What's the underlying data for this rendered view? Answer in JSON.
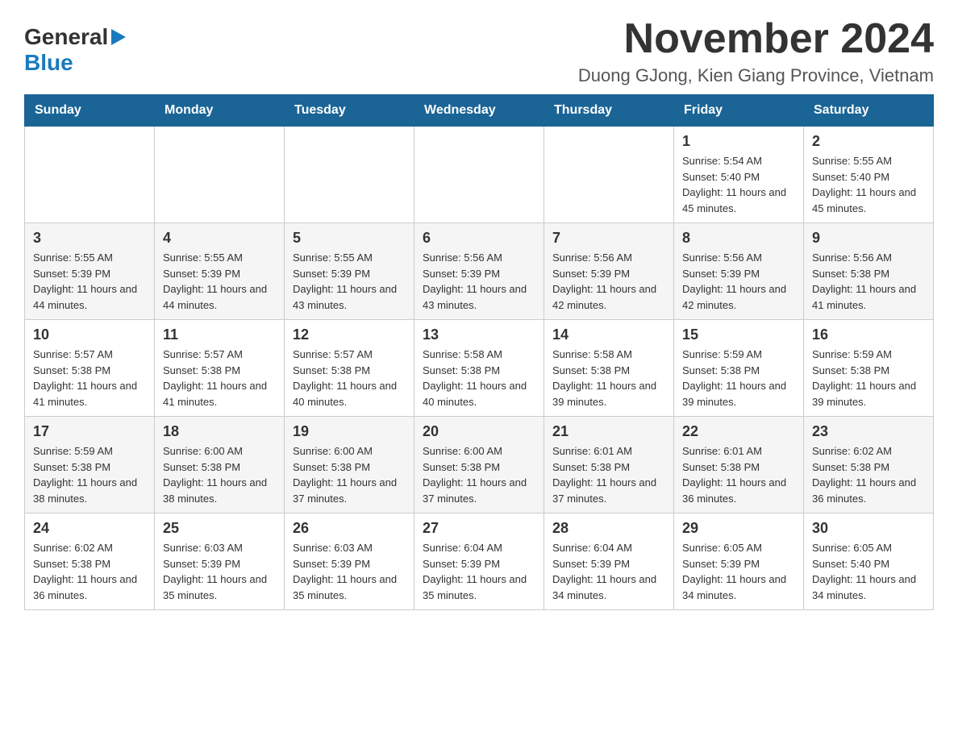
{
  "header": {
    "logo_general": "General",
    "logo_blue": "Blue",
    "month_title": "November 2024",
    "location": "Duong GJong, Kien Giang Province, Vietnam"
  },
  "weekdays": [
    "Sunday",
    "Monday",
    "Tuesday",
    "Wednesday",
    "Thursday",
    "Friday",
    "Saturday"
  ],
  "weeks": [
    [
      {
        "day": "",
        "info": ""
      },
      {
        "day": "",
        "info": ""
      },
      {
        "day": "",
        "info": ""
      },
      {
        "day": "",
        "info": ""
      },
      {
        "day": "",
        "info": ""
      },
      {
        "day": "1",
        "info": "Sunrise: 5:54 AM\nSunset: 5:40 PM\nDaylight: 11 hours and 45 minutes."
      },
      {
        "day": "2",
        "info": "Sunrise: 5:55 AM\nSunset: 5:40 PM\nDaylight: 11 hours and 45 minutes."
      }
    ],
    [
      {
        "day": "3",
        "info": "Sunrise: 5:55 AM\nSunset: 5:39 PM\nDaylight: 11 hours and 44 minutes."
      },
      {
        "day": "4",
        "info": "Sunrise: 5:55 AM\nSunset: 5:39 PM\nDaylight: 11 hours and 44 minutes."
      },
      {
        "day": "5",
        "info": "Sunrise: 5:55 AM\nSunset: 5:39 PM\nDaylight: 11 hours and 43 minutes."
      },
      {
        "day": "6",
        "info": "Sunrise: 5:56 AM\nSunset: 5:39 PM\nDaylight: 11 hours and 43 minutes."
      },
      {
        "day": "7",
        "info": "Sunrise: 5:56 AM\nSunset: 5:39 PM\nDaylight: 11 hours and 42 minutes."
      },
      {
        "day": "8",
        "info": "Sunrise: 5:56 AM\nSunset: 5:39 PM\nDaylight: 11 hours and 42 minutes."
      },
      {
        "day": "9",
        "info": "Sunrise: 5:56 AM\nSunset: 5:38 PM\nDaylight: 11 hours and 41 minutes."
      }
    ],
    [
      {
        "day": "10",
        "info": "Sunrise: 5:57 AM\nSunset: 5:38 PM\nDaylight: 11 hours and 41 minutes."
      },
      {
        "day": "11",
        "info": "Sunrise: 5:57 AM\nSunset: 5:38 PM\nDaylight: 11 hours and 41 minutes."
      },
      {
        "day": "12",
        "info": "Sunrise: 5:57 AM\nSunset: 5:38 PM\nDaylight: 11 hours and 40 minutes."
      },
      {
        "day": "13",
        "info": "Sunrise: 5:58 AM\nSunset: 5:38 PM\nDaylight: 11 hours and 40 minutes."
      },
      {
        "day": "14",
        "info": "Sunrise: 5:58 AM\nSunset: 5:38 PM\nDaylight: 11 hours and 39 minutes."
      },
      {
        "day": "15",
        "info": "Sunrise: 5:59 AM\nSunset: 5:38 PM\nDaylight: 11 hours and 39 minutes."
      },
      {
        "day": "16",
        "info": "Sunrise: 5:59 AM\nSunset: 5:38 PM\nDaylight: 11 hours and 39 minutes."
      }
    ],
    [
      {
        "day": "17",
        "info": "Sunrise: 5:59 AM\nSunset: 5:38 PM\nDaylight: 11 hours and 38 minutes."
      },
      {
        "day": "18",
        "info": "Sunrise: 6:00 AM\nSunset: 5:38 PM\nDaylight: 11 hours and 38 minutes."
      },
      {
        "day": "19",
        "info": "Sunrise: 6:00 AM\nSunset: 5:38 PM\nDaylight: 11 hours and 37 minutes."
      },
      {
        "day": "20",
        "info": "Sunrise: 6:00 AM\nSunset: 5:38 PM\nDaylight: 11 hours and 37 minutes."
      },
      {
        "day": "21",
        "info": "Sunrise: 6:01 AM\nSunset: 5:38 PM\nDaylight: 11 hours and 37 minutes."
      },
      {
        "day": "22",
        "info": "Sunrise: 6:01 AM\nSunset: 5:38 PM\nDaylight: 11 hours and 36 minutes."
      },
      {
        "day": "23",
        "info": "Sunrise: 6:02 AM\nSunset: 5:38 PM\nDaylight: 11 hours and 36 minutes."
      }
    ],
    [
      {
        "day": "24",
        "info": "Sunrise: 6:02 AM\nSunset: 5:38 PM\nDaylight: 11 hours and 36 minutes."
      },
      {
        "day": "25",
        "info": "Sunrise: 6:03 AM\nSunset: 5:39 PM\nDaylight: 11 hours and 35 minutes."
      },
      {
        "day": "26",
        "info": "Sunrise: 6:03 AM\nSunset: 5:39 PM\nDaylight: 11 hours and 35 minutes."
      },
      {
        "day": "27",
        "info": "Sunrise: 6:04 AM\nSunset: 5:39 PM\nDaylight: 11 hours and 35 minutes."
      },
      {
        "day": "28",
        "info": "Sunrise: 6:04 AM\nSunset: 5:39 PM\nDaylight: 11 hours and 34 minutes."
      },
      {
        "day": "29",
        "info": "Sunrise: 6:05 AM\nSunset: 5:39 PM\nDaylight: 11 hours and 34 minutes."
      },
      {
        "day": "30",
        "info": "Sunrise: 6:05 AM\nSunset: 5:40 PM\nDaylight: 11 hours and 34 minutes."
      }
    ]
  ]
}
